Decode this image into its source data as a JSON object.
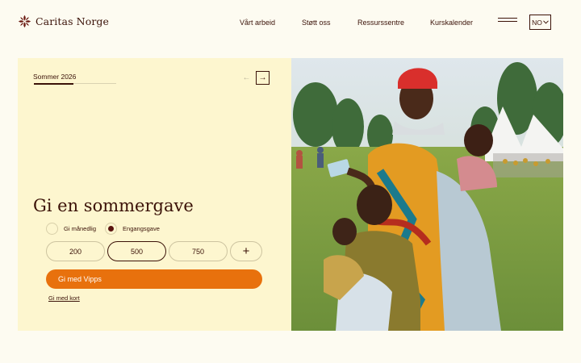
{
  "header": {
    "brand": "Caritas Norge",
    "nav": [
      "Vårt arbeid",
      "Støtt oss",
      "Ressurssentre",
      "Kurskalender"
    ],
    "lang": "NO"
  },
  "hero": {
    "slide_label": "Sommer 2026",
    "progress": 0.48,
    "headline": "Gi en sommergave",
    "frequency": {
      "monthly": "Gi månedlig",
      "once": "Engangsgave",
      "selected": "once"
    },
    "amounts": [
      "200",
      "500",
      "750"
    ],
    "selected_amount": "500",
    "add_amount": "+",
    "vipps_button": "Gi med Vipps",
    "card_link": "Gi med kort"
  },
  "colors": {
    "brand": "#3b1208",
    "accent": "#e8710d",
    "panel": "#fdf6cf",
    "background": "#fdfbf1"
  }
}
